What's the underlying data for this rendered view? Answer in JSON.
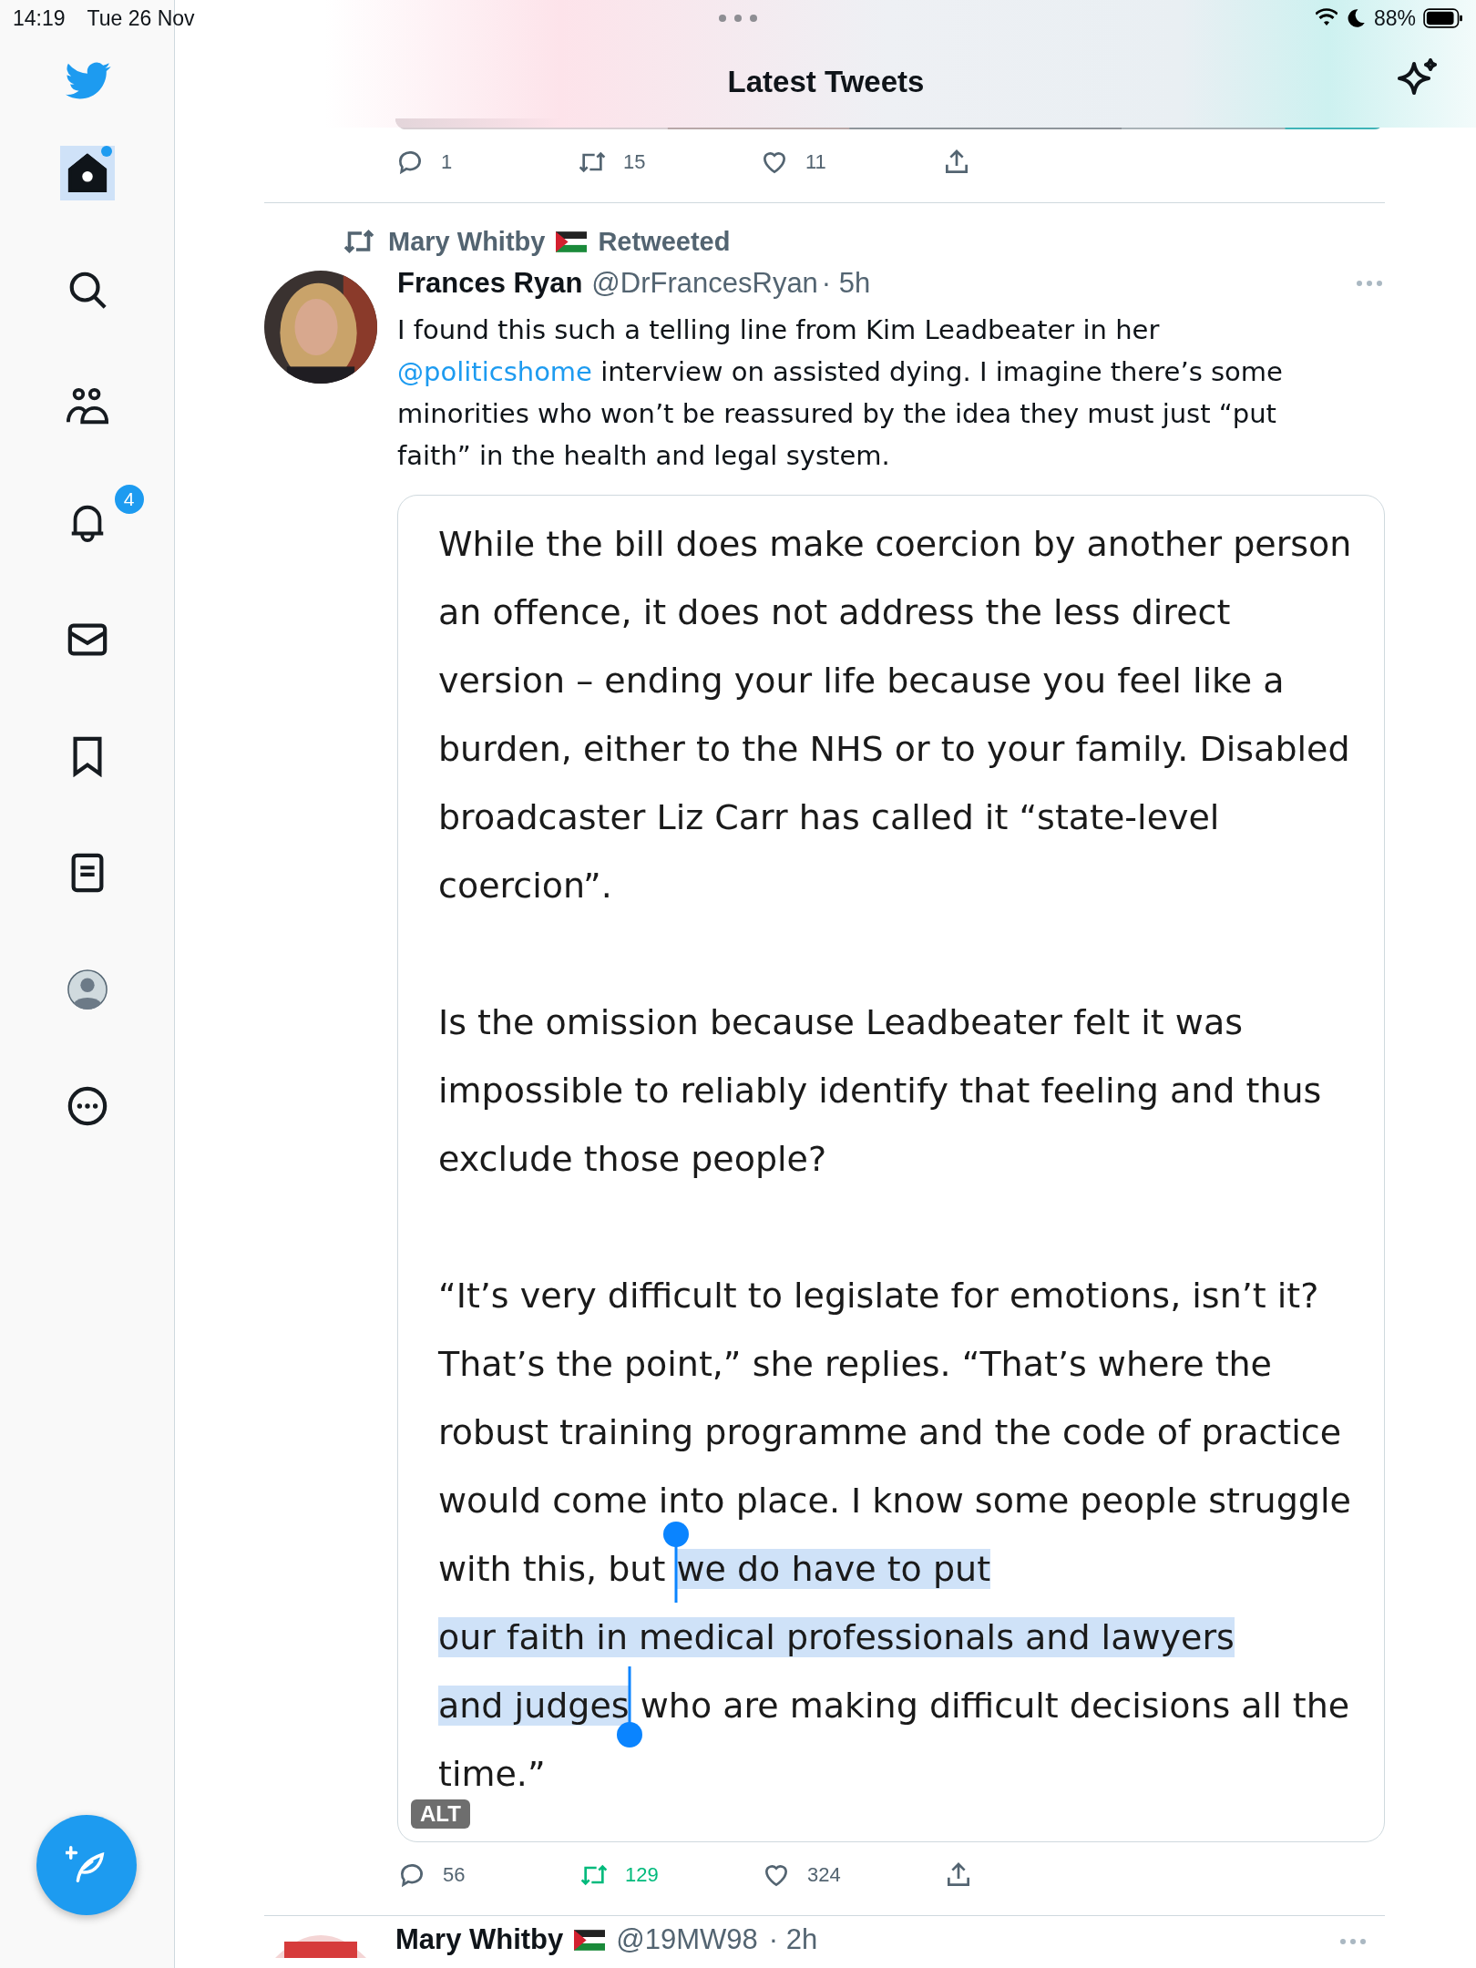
{
  "status_bar": {
    "time": "14:19",
    "date": "Tue 26 Nov",
    "battery": "88%"
  },
  "header": {
    "title": "Latest Tweets"
  },
  "sidebar": {
    "items": [
      {
        "kind": "home",
        "selected": true,
        "dot": true
      },
      {
        "kind": "search",
        "selected": false
      },
      {
        "kind": "communities",
        "selected": false
      },
      {
        "kind": "notifications",
        "selected": false,
        "badge": "4"
      },
      {
        "kind": "messages",
        "selected": false
      },
      {
        "kind": "bookmarks",
        "selected": false
      },
      {
        "kind": "lists",
        "selected": false
      },
      {
        "kind": "profile",
        "selected": false
      },
      {
        "kind": "more",
        "selected": false
      }
    ]
  },
  "previous_tweet": {
    "actions": {
      "replies": "1",
      "retweets": "15",
      "likes": "11",
      "retweeted": false,
      "liked": false
    }
  },
  "tweet": {
    "retweeted_by": {
      "name": "Mary Whitby",
      "label": "Retweeted"
    },
    "author": {
      "name": "Frances Ryan",
      "handle": "@DrFrancesRyan",
      "time": "· 5h"
    },
    "text": [
      {
        "kind": "text",
        "text": "I found this such a telling line from Kim Leadbeater in her "
      },
      {
        "kind": "link",
        "text": "@politicshome"
      },
      {
        "kind": "text",
        "text": " interview on assisted dying. I imagine there’s some minorities who won’t be reassured by the idea they must just “put faith” in the health and legal system."
      }
    ],
    "image": {
      "paragraphs": [
        [
          {
            "text": "While the bill does make coercion by another person an offence, it does not address the less direct version – ending your life because you feel like a burden, either to the NHS or to your family. Disabled broadcaster Liz Carr has called it “state-level coercion”.",
            "selected": false
          }
        ],
        [
          {
            "text": "Is the omission because Leadbeater felt it was impossible to reliably identify that feeling and thus exclude those people?",
            "selected": false
          }
        ],
        [
          {
            "text": "“It’s very difficult to legislate for emotions, isn’t it? That’s the point,” she replies. “That’s where the robust training programme and the code of practice would come into place. I know some people struggle with this, but ",
            "selected": false
          },
          {
            "text": "we do have to put",
            "selected": true
          },
          {
            "text": "our faith in medical professionals and lawyers",
            "selected": true
          },
          {
            "text": "and judges",
            "selected": true
          },
          {
            "text": " who are making difficult decisions all the time.”",
            "selected": false
          }
        ]
      ],
      "alt_badge": "ALT"
    },
    "actions": {
      "replies": "56",
      "retweets": "129",
      "likes": "324",
      "retweeted": true,
      "liked": false
    }
  },
  "next_tweet": {
    "author": {
      "name": "Mary Whitby",
      "handle": "@19MW98",
      "time": "· 2h"
    }
  }
}
